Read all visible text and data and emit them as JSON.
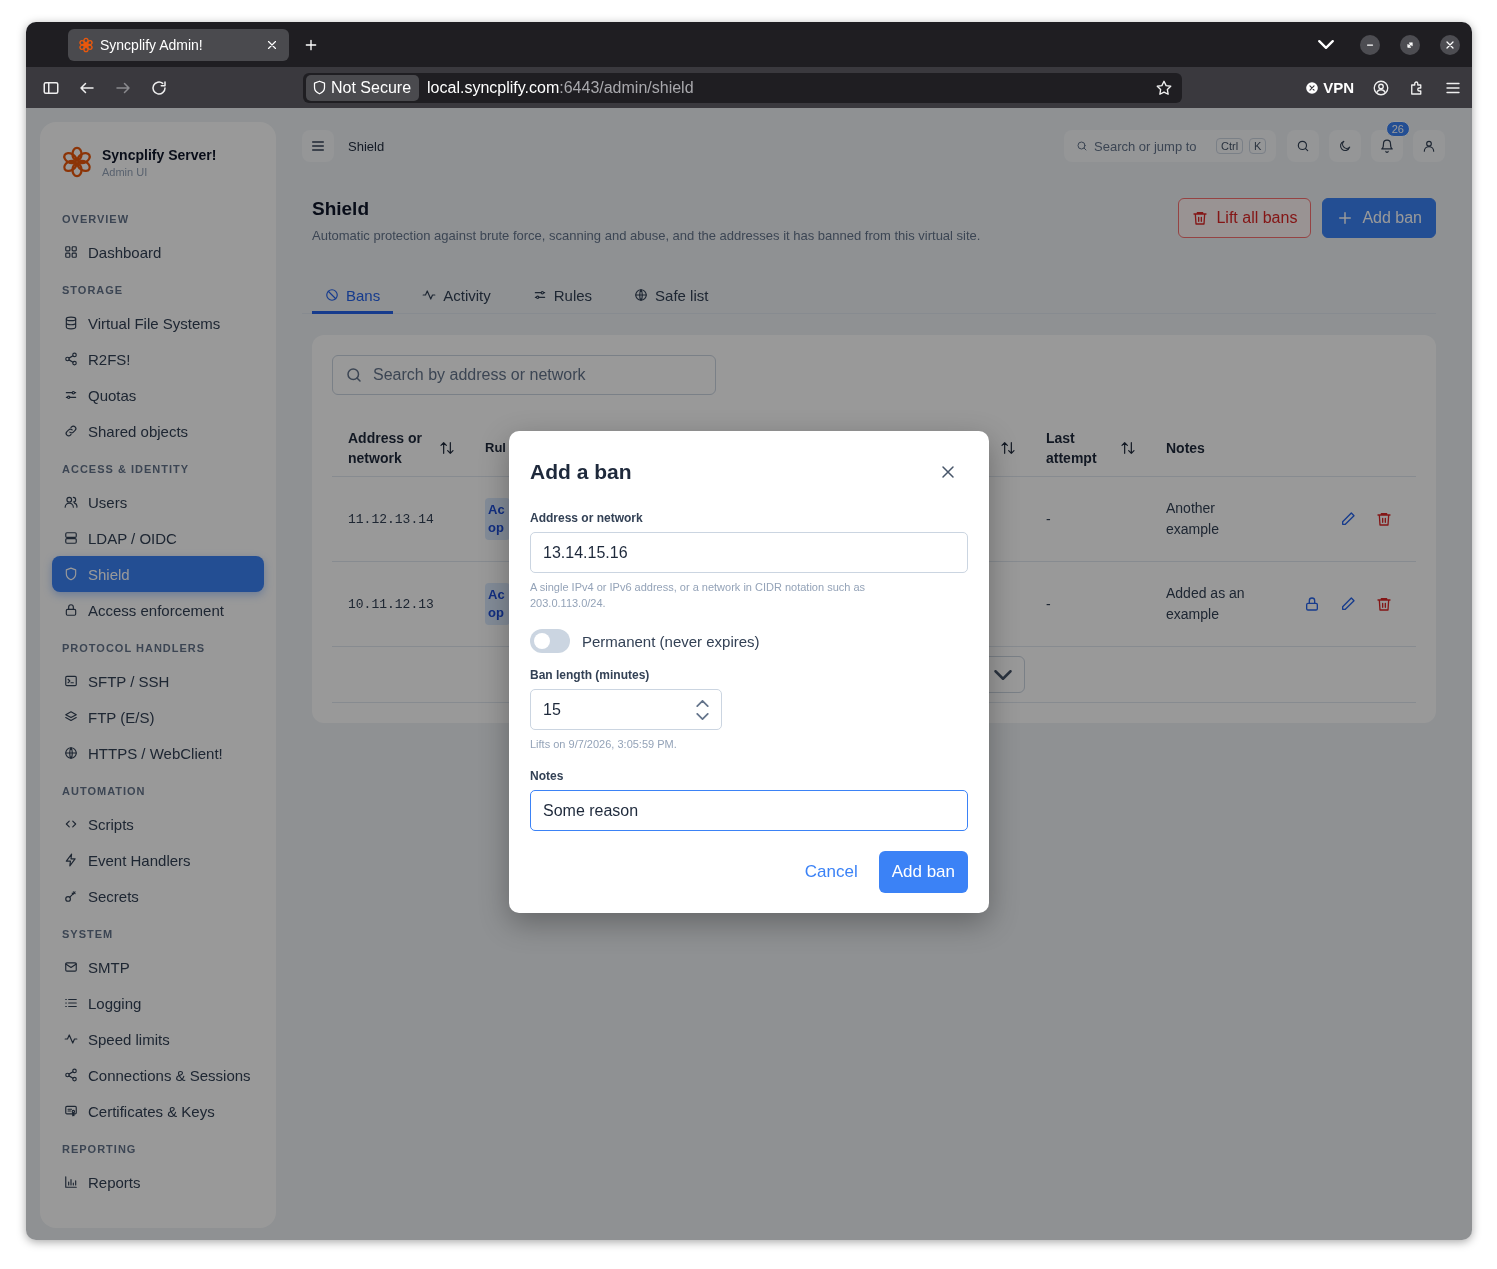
{
  "browser": {
    "tab_title": "Syncplify Admin!",
    "security_label": "Not Secure",
    "url_host": "local.syncplify.com",
    "url_path": ":6443/admin/shield",
    "vpn_label": "VPN"
  },
  "sidebar": {
    "brand": "Syncplify Server!",
    "subtitle": "Admin UI",
    "sections": [
      {
        "label": "OVERVIEW",
        "items": [
          {
            "label": "Dashboard",
            "selected": false
          }
        ]
      },
      {
        "label": "STORAGE",
        "items": [
          {
            "label": "Virtual File Systems",
            "selected": false
          },
          {
            "label": "R2FS!",
            "selected": false
          },
          {
            "label": "Quotas",
            "selected": false
          },
          {
            "label": "Shared objects",
            "selected": false
          }
        ]
      },
      {
        "label": "ACCESS & IDENTITY",
        "items": [
          {
            "label": "Users",
            "selected": false
          },
          {
            "label": "LDAP / OIDC",
            "selected": false
          },
          {
            "label": "Shield",
            "selected": true
          },
          {
            "label": "Access enforcement",
            "selected": false
          }
        ]
      },
      {
        "label": "PROTOCOL HANDLERS",
        "items": [
          {
            "label": "SFTP / SSH",
            "selected": false
          },
          {
            "label": "FTP (E/S)",
            "selected": false
          },
          {
            "label": "HTTPS / WebClient!",
            "selected": false
          }
        ]
      },
      {
        "label": "AUTOMATION",
        "items": [
          {
            "label": "Scripts",
            "selected": false
          },
          {
            "label": "Event Handlers",
            "selected": false
          },
          {
            "label": "Secrets",
            "selected": false
          }
        ]
      },
      {
        "label": "SYSTEM",
        "items": [
          {
            "label": "SMTP",
            "selected": false
          },
          {
            "label": "Logging",
            "selected": false
          },
          {
            "label": "Speed limits",
            "selected": false
          },
          {
            "label": "Connections & Sessions",
            "selected": false
          },
          {
            "label": "Certificates & Keys",
            "selected": false
          }
        ]
      },
      {
        "label": "REPORTING",
        "items": [
          {
            "label": "Reports",
            "selected": false
          }
        ]
      }
    ]
  },
  "topbar": {
    "breadcrumb": "Shield",
    "search_placeholder": "Search or jump to",
    "shortcut_keys": [
      "Ctrl",
      "K"
    ],
    "notification_count": "26"
  },
  "page": {
    "title": "Shield",
    "subtitle": "Automatic protection against brute force, scanning and abuse, and the addresses it has banned from this virtual site.",
    "actions": [
      {
        "label": "Lift all bans",
        "kind": "danger"
      },
      {
        "label": "Add ban",
        "kind": "primary"
      }
    ]
  },
  "tabs": [
    {
      "label": "Bans",
      "selected": true
    },
    {
      "label": "Activity",
      "selected": false
    },
    {
      "label": "Rules",
      "selected": false
    },
    {
      "label": "Safe list",
      "selected": false
    }
  ],
  "bans": {
    "search": {
      "placeholder": "Search by address or network"
    },
    "columns": [
      {
        "label": "Address or network",
        "sortable": true
      },
      {
        "label": "Rul"
      },
      {
        "sortable": true
      },
      {
        "label": "Last attempt",
        "sortable": true
      },
      {
        "label": "Notes",
        "sortable": false
      }
    ],
    "rows": [
      {
        "address": "11.12.13.14",
        "rule": "Ac op",
        "last_attempt": "-",
        "notes": "Another example",
        "locked": false
      },
      {
        "address": "10.11.12.13",
        "rule": "Ac op",
        "last_attempt": "-",
        "notes": "Added as an example",
        "locked": true
      }
    ]
  },
  "modal": {
    "title": "Add a ban",
    "address_label": "Address or network",
    "address_value": "13.14.15.16",
    "address_help": "A single IPv4 or IPv6 address, or a network in CIDR notation such as 203.0.113.0/24.",
    "permanent": {
      "label": "Permanent (never expires)",
      "on": false
    },
    "length_label": "Ban length (minutes)",
    "length_value": "15",
    "length_help": "Lifts on 9/7/2026, 3:05:59 PM.",
    "notes_label": "Notes",
    "notes_value": "Some reason",
    "notes_focused": true,
    "cancel": "Cancel",
    "submit": "Add ban"
  }
}
